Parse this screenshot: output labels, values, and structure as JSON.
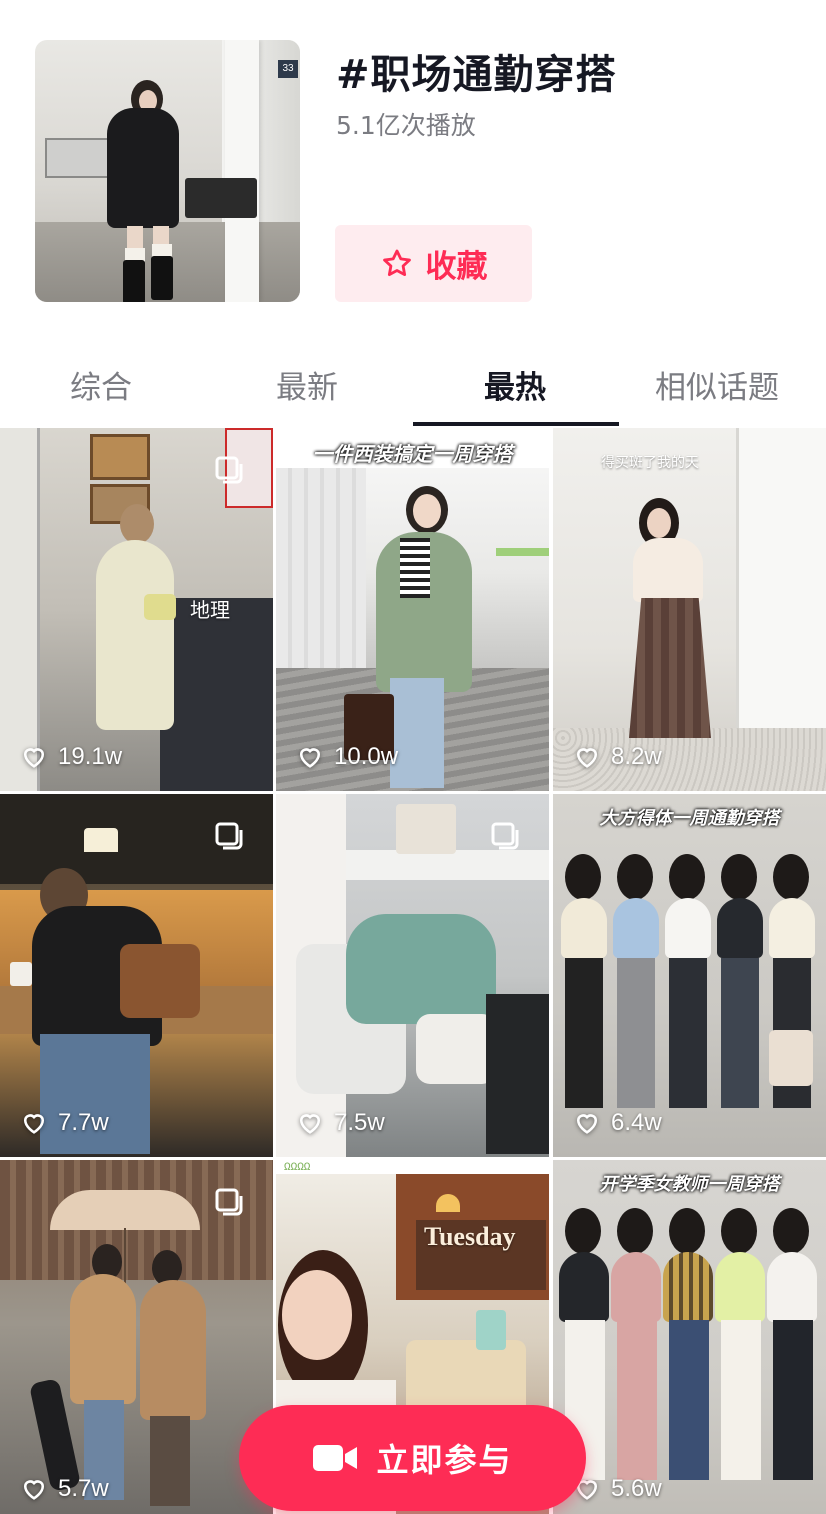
{
  "topic": {
    "title": "#职场通勤穿搭",
    "views": "5.1亿次播放",
    "favorite_label": "收藏",
    "favorite_icon": "star-outline-icon",
    "accent_color": "#fe2c55"
  },
  "tabs": [
    {
      "label": "综合",
      "active": false
    },
    {
      "label": "最新",
      "active": false
    },
    {
      "label": "最热",
      "active": true
    },
    {
      "label": "相似话题",
      "active": false
    }
  ],
  "videos": [
    {
      "likes": "19.1w",
      "overlay": "地理",
      "caption": "",
      "multi_image": true
    },
    {
      "likes": "10.0w",
      "overlay": "",
      "caption": "一件西装搞定一周穿搭",
      "multi_image": false
    },
    {
      "likes": "8.2w",
      "overlay": "得买斑了我的天",
      "caption": "",
      "multi_image": false
    },
    {
      "likes": "7.7w",
      "overlay": "",
      "caption": "",
      "multi_image": true
    },
    {
      "likes": "7.5w",
      "overlay": "",
      "caption": "",
      "multi_image": true
    },
    {
      "likes": "6.4w",
      "overlay": "",
      "caption": "大方得体一周通勤穿搭",
      "multi_image": false
    },
    {
      "likes": "5.7w",
      "overlay": "",
      "caption": "",
      "multi_image": true
    },
    {
      "likes": "",
      "overlay": "Tuesday",
      "caption": "",
      "multi_image": false
    },
    {
      "likes": "5.6w",
      "overlay": "",
      "caption": "开学季女教师一周穿搭",
      "multi_image": false
    }
  ],
  "cta": {
    "label": "立即参与",
    "icon": "video-camera-icon"
  }
}
